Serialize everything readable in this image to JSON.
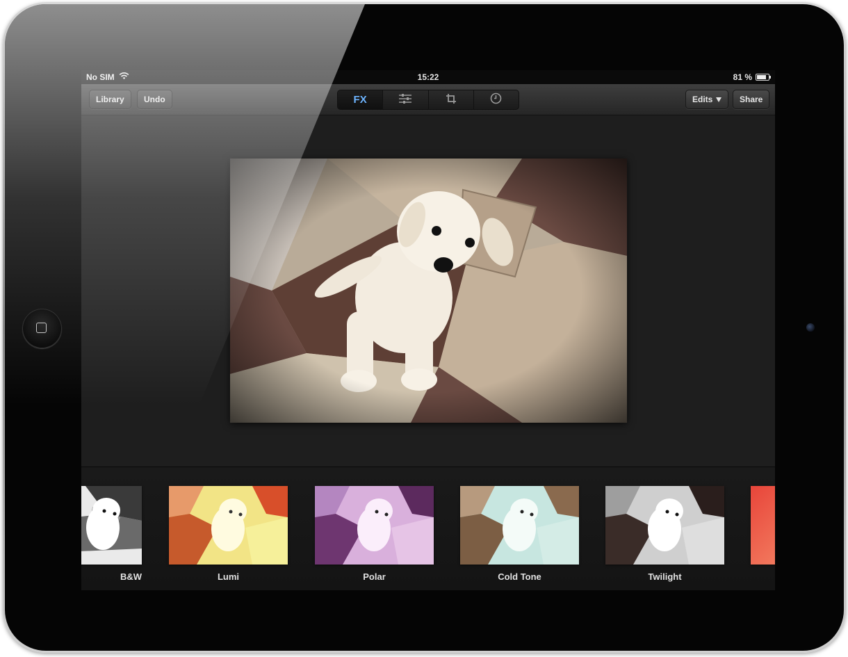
{
  "status_bar": {
    "carrier": "No SIM",
    "time": "15:22",
    "battery": "81 %",
    "battery_level": 0.81
  },
  "toolbar": {
    "library_label": "Library",
    "undo_label": "Undo",
    "tabs": [
      {
        "label": "FX",
        "icon": "fx",
        "active": true
      },
      {
        "label": "",
        "icon": "sliders-icon",
        "active": false
      },
      {
        "label": "",
        "icon": "crop-icon",
        "active": false
      },
      {
        "label": "",
        "icon": "history-clock-icon",
        "active": false
      }
    ],
    "edits_label": "Edits",
    "share_label": "Share"
  },
  "filters": [
    {
      "label": "B&W"
    },
    {
      "label": "Lumi"
    },
    {
      "label": "Polar"
    },
    {
      "label": "Cold Tone"
    },
    {
      "label": "Twilight"
    }
  ],
  "colors": {
    "accent": "#6db4ff",
    "toolbar_bg": "#2e2e2e",
    "screen_bg": "#1c1c1c"
  }
}
